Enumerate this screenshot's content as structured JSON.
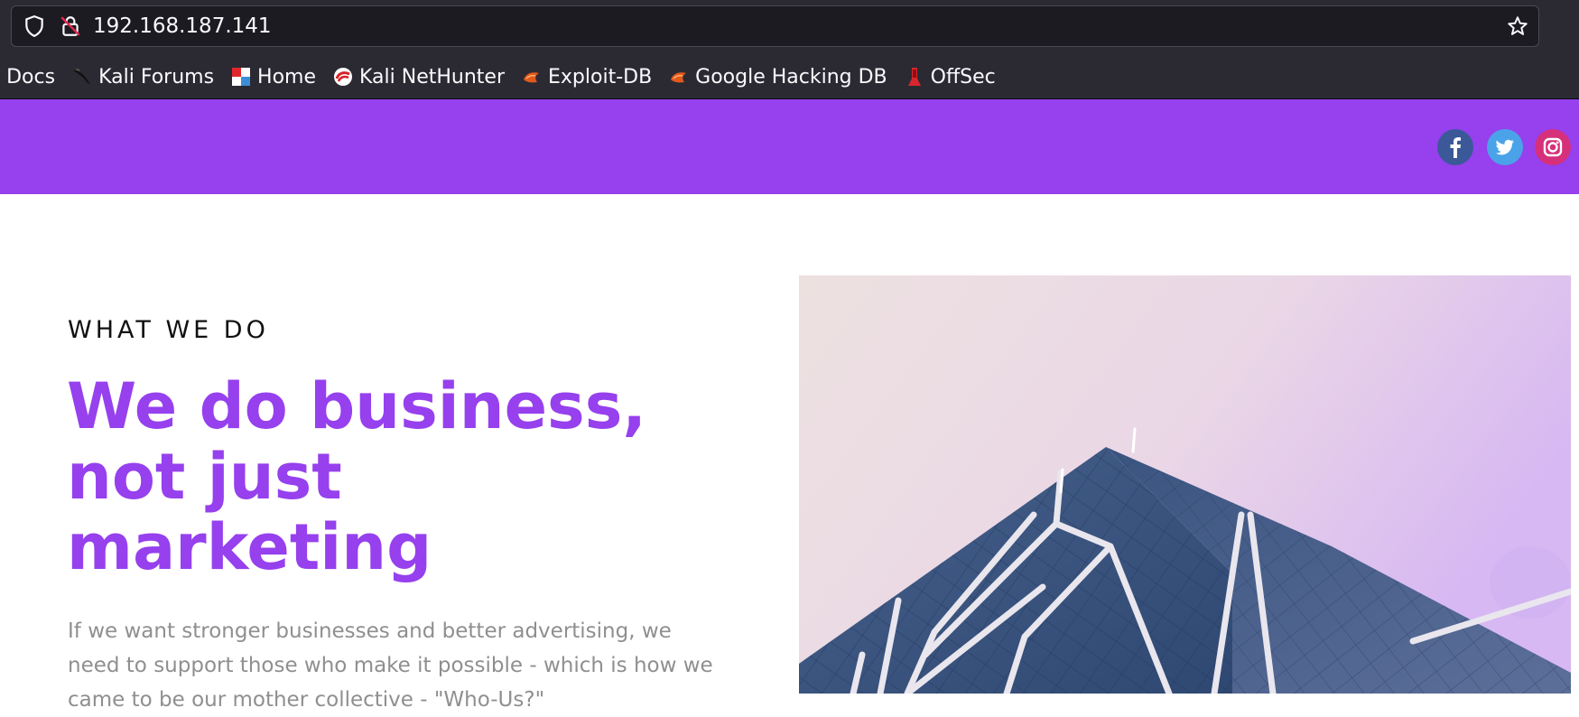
{
  "browser": {
    "url": "192.168.187.141",
    "bookmarks": [
      {
        "label": "i Docs",
        "icon": "kali-docs-icon"
      },
      {
        "label": "Kali Forums",
        "icon": "kali-dragon-icon"
      },
      {
        "label": "Home",
        "icon": "home-favicon"
      },
      {
        "label": "Kali NetHunter",
        "icon": "nethunter-icon"
      },
      {
        "label": "Exploit-DB",
        "icon": "exploit-db-icon"
      },
      {
        "label": "Google Hacking DB",
        "icon": "ghdb-icon"
      },
      {
        "label": "OffSec",
        "icon": "offsec-icon"
      }
    ]
  },
  "header": {
    "background": "#9640ee",
    "social": [
      "facebook-icon",
      "twitter-icon",
      "instagram-icon"
    ]
  },
  "main": {
    "eyebrow": "WHAT WE DO",
    "headline_lines": [
      "We do business,",
      "not just",
      "marketing"
    ],
    "body": "If we want stronger businesses and better advertising, we need to support those who make it possible - which is how we came to be our mother collective - \"Who-Us?\""
  },
  "colors": {
    "accent": "#9640ee",
    "body_text": "#8f8f8f",
    "chrome_bg": "#2b2a33"
  }
}
